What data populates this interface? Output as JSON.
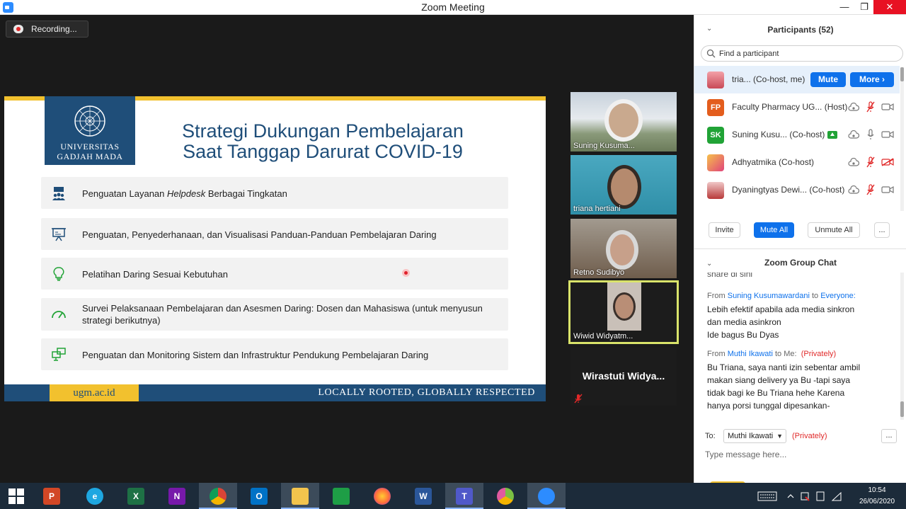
{
  "window": {
    "title": "Zoom Meeting",
    "minimize": "—",
    "maximize": "❐",
    "close": "✕"
  },
  "recording": {
    "label": "Recording..."
  },
  "slide": {
    "logo_line1": "UNIVERSITAS",
    "logo_line2": "GADJAH MADA",
    "title_line1": "Strategi Dukungan Pembelajaran",
    "title_line2": "Saat Tanggap Darurat COVID-19",
    "items": [
      {
        "pre": "Penguatan Layanan ",
        "em": "Helpdesk",
        "post": " Berbagai Tingkatan"
      },
      {
        "text": "Penguatan, Penyederhanaan, dan Visualisasi Panduan-Panduan Pembelajaran Daring"
      },
      {
        "text": "Pelatihan Daring Sesuai Kebutuhan"
      },
      {
        "line1": "Survei Pelaksanaan Pembelajaran dan Asesmen Daring: Dosen dan Mahasiswa (untuk menyusun",
        "line2": "strategi berikutnya)"
      },
      {
        "text": "Penguatan dan Monitoring Sistem dan Infrastruktur Pendukung Pembelajaran Daring"
      }
    ],
    "footer_url": "ugm.ac.id",
    "footer_motto": "LOCALLY ROOTED, GLOBALLY RESPECTED"
  },
  "thumbnails": [
    {
      "name": "Suning Kusuma..."
    },
    {
      "name": "triana hertiani"
    },
    {
      "name": "Retno Sudibyo"
    },
    {
      "name": "Wiwid Widyatm..."
    },
    {
      "name": "Wirastuti  Widya..."
    }
  ],
  "participants": {
    "title": "Participants (52)",
    "search_placeholder": "Find a participant",
    "rows": [
      {
        "name": "tria...  (Co-host, me)",
        "mute_label": "Mute",
        "more_label": "More ›"
      },
      {
        "initials": "FP",
        "name": "Faculty Pharmacy UG...  (Host)",
        "color": "#e35d1d"
      },
      {
        "initials": "SK",
        "name": "Suning Kusu...   (Co-host)",
        "color": "#21a336"
      },
      {
        "name": "Adhyatmika (Co-host)"
      },
      {
        "name": "Dyaningtyas Dewi...  (Co-host)"
      }
    ],
    "actions": {
      "invite": "Invite",
      "mute_all": "Mute All",
      "unmute_all": "Unmute All",
      "more": "..."
    }
  },
  "chat": {
    "title": "Zoom Group Chat",
    "cut_text": "share di sini",
    "messages": [
      {
        "from_label": "From ",
        "sender": "Suning Kusumawardani",
        "to_label": " to ",
        "recipient": "Everyone",
        "colon": ":",
        "lines": [
          "Lebih efektif apabila ada media sinkron",
          "dan media asinkron",
          "Ide bagus Bu Dyas"
        ]
      },
      {
        "from_label": "From ",
        "sender": "Muthi Ikawati",
        "to_label": " to Me:",
        "privately": "(Privately)",
        "lines": [
          "Bu Triana, saya nanti izin sebentar ambil",
          "makan siang delivery ya Bu -tapi saya",
          "tidak bagi ke Bu Triana hehe Karena",
          "hanya porsi tunggal dipesankan-"
        ]
      }
    ],
    "to_label": "To:",
    "to_value": "Muthi Ikawati",
    "to_privately": "(Privately)",
    "more": "...",
    "input_placeholder": "Type message here..."
  },
  "taskbar": {
    "apps": [
      {
        "label": "P",
        "color": "#d24726"
      },
      {
        "label": "e",
        "color": "#1ea7e1"
      },
      {
        "label": "X",
        "color": "#1e7145"
      },
      {
        "label": "N",
        "color": "#7719aa"
      },
      {
        "label": "",
        "color": "#e8e8e8"
      },
      {
        "label": "O",
        "color": "#0072c6"
      },
      {
        "label": "",
        "color": "#f3c44d"
      },
      {
        "label": "",
        "color": "#1e9e46"
      },
      {
        "label": "",
        "color": "#ff7139"
      },
      {
        "label": "W",
        "color": "#2b579a"
      },
      {
        "label": "T",
        "color": "#5059c9"
      },
      {
        "label": "",
        "color": "#7ac043"
      },
      {
        "label": "",
        "color": "#2d8cff"
      }
    ],
    "time": "10:54",
    "date": "26/06/2020"
  }
}
